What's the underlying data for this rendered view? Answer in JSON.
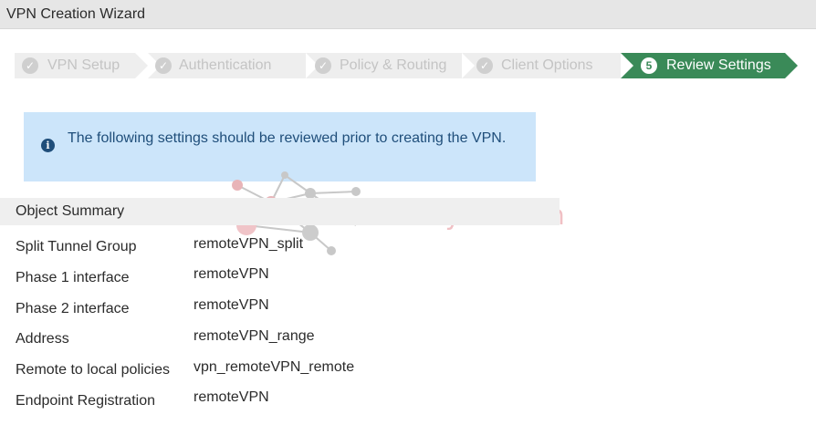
{
  "window": {
    "title": "VPN Creation Wizard"
  },
  "wizard": {
    "steps": [
      {
        "label": "VPN Setup",
        "icon": "checkmark-icon",
        "state": "done"
      },
      {
        "label": "Authentication",
        "icon": "checkmark-icon",
        "state": "done"
      },
      {
        "label": "Policy & Routing",
        "icon": "checkmark-icon",
        "state": "done"
      },
      {
        "label": "Client Options",
        "icon": "checkmark-icon",
        "state": "done"
      },
      {
        "label": "Review Settings",
        "number": "5",
        "state": "active"
      }
    ],
    "check_glyph": "✓",
    "active_color": "#3a8a58"
  },
  "info": {
    "icon": "info-icon",
    "icon_glyph": "i",
    "text": "The following settings should be reviewed prior to creating the VPN."
  },
  "summary": {
    "title": "Object Summary",
    "rows": [
      {
        "label": "Split Tunnel Group",
        "value": "remoteVPN_split"
      },
      {
        "label": "Phase 1 interface",
        "value": "remoteVPN"
      },
      {
        "label": "Phase 2 interface",
        "value": "remoteVPN"
      },
      {
        "label": "Address",
        "value": "remoteVPN_range"
      },
      {
        "label": "Remote to local policies",
        "value": "vpn_remoteVPN_remote"
      },
      {
        "label": "Endpoint Registration",
        "value": "remoteVPN"
      }
    ]
  },
  "watermark": {
    "text": "securityzone.vn"
  }
}
